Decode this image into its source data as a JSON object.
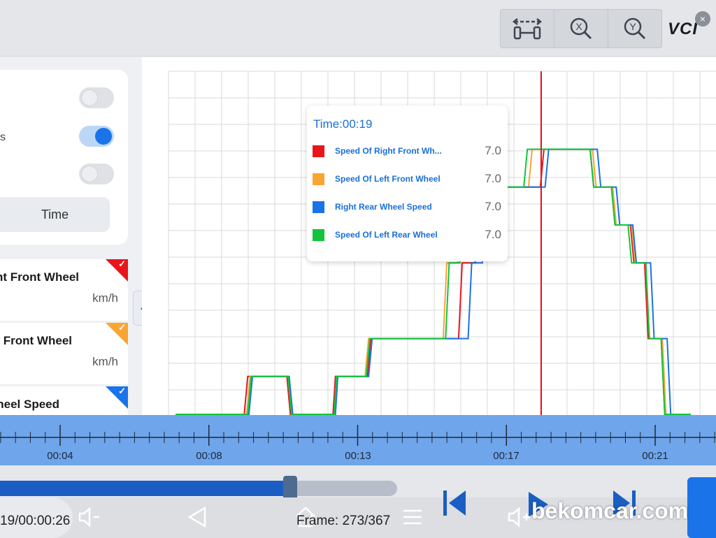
{
  "toolbar": {
    "icons": [
      "axis-expand-icon",
      "zoom-x-icon",
      "zoom-y-icon"
    ],
    "brand": "VCI",
    "brand_close": "×"
  },
  "left_panel": {
    "toggles": [
      false,
      true,
      false
    ],
    "toggle_partial_label": "s",
    "time_button": "Time"
  },
  "signals": [
    {
      "name": "nt Front Wheel",
      "unit": "km/h",
      "color": "#e8161b"
    },
    {
      "name": "Front Wheel",
      "unit": "km/h",
      "color": "#f9a533"
    },
    {
      "name": "heel Speed",
      "unit": "",
      "color": "#1a73e8"
    }
  ],
  "collapse": "«",
  "tooltip": {
    "time": "Time:00:19",
    "rows": [
      {
        "name": "Speed Of Right Front Wh...",
        "value": "7.0",
        "color": "#e8161b"
      },
      {
        "name": "Speed Of Left Front Wheel",
        "value": "7.0",
        "color": "#f9a533"
      },
      {
        "name": "Right Rear Wheel Speed",
        "value": "7.0",
        "color": "#1a73e8"
      },
      {
        "name": "Speed Of Left Rear Wheel",
        "value": "7.0",
        "color": "#12c43c"
      }
    ]
  },
  "timeline": {
    "labels": [
      "00:04",
      "00:08",
      "00:13",
      "00:17",
      "00:21"
    ]
  },
  "playback": {
    "time": "19/00:00:26",
    "frame": "Frame: 273/367",
    "progress": 0.73
  },
  "watermark": "bekomcar.com",
  "chart_data": {
    "type": "line",
    "xlabel": "",
    "ylabel": "",
    "cursor_time": "00:19",
    "series": [
      {
        "name": "Speed Of Right Front Wheel",
        "color": "#e8161b",
        "points": [
          [
            0,
            0
          ],
          [
            5.8,
            0
          ],
          [
            6.1,
            1
          ],
          [
            9.4,
            1
          ],
          [
            9.7,
            0
          ],
          [
            13.3,
            0
          ],
          [
            13.5,
            1
          ],
          [
            16.2,
            1
          ],
          [
            16.5,
            2
          ],
          [
            23.9,
            2
          ],
          [
            24.2,
            4
          ],
          [
            25.3,
            4
          ],
          [
            25.6,
            6
          ],
          [
            30.8,
            6
          ],
          [
            31.1,
            7
          ],
          [
            35.0,
            7
          ],
          [
            35.3,
            6
          ],
          [
            36.8,
            6
          ],
          [
            37.1,
            5
          ],
          [
            38.4,
            5
          ],
          [
            38.7,
            4
          ],
          [
            39.6,
            4
          ],
          [
            39.9,
            2
          ],
          [
            41.0,
            2
          ],
          [
            41.3,
            0
          ],
          [
            43.5,
            0
          ]
        ]
      },
      {
        "name": "Speed Of Left Front Wheel",
        "color": "#f9a533",
        "points": [
          [
            0,
            0
          ],
          [
            6.0,
            0
          ],
          [
            6.3,
            1
          ],
          [
            9.5,
            1
          ],
          [
            9.8,
            0
          ],
          [
            13.4,
            0
          ],
          [
            13.6,
            1
          ],
          [
            16.0,
            1
          ],
          [
            16.3,
            2
          ],
          [
            22.6,
            2
          ],
          [
            22.9,
            4
          ],
          [
            23.8,
            4
          ],
          [
            24.1,
            6
          ],
          [
            29.8,
            6
          ],
          [
            30.1,
            7
          ],
          [
            35.2,
            7
          ],
          [
            35.5,
            6
          ],
          [
            36.9,
            6
          ],
          [
            37.2,
            5
          ],
          [
            38.5,
            5
          ],
          [
            38.8,
            4
          ],
          [
            39.7,
            4
          ],
          [
            40.0,
            2
          ],
          [
            41.1,
            2
          ],
          [
            41.4,
            0
          ],
          [
            43.5,
            0
          ]
        ]
      },
      {
        "name": "Right Rear Wheel Speed",
        "color": "#1a73e8",
        "points": [
          [
            0,
            0
          ],
          [
            6.2,
            0
          ],
          [
            6.5,
            1
          ],
          [
            9.6,
            1
          ],
          [
            9.9,
            0
          ],
          [
            13.5,
            0
          ],
          [
            13.7,
            1
          ],
          [
            16.3,
            1
          ],
          [
            16.6,
            2
          ],
          [
            24.7,
            2
          ],
          [
            25.0,
            4
          ],
          [
            25.9,
            4
          ],
          [
            26.2,
            6
          ],
          [
            31.2,
            6
          ],
          [
            31.5,
            7
          ],
          [
            35.6,
            7
          ],
          [
            35.9,
            6
          ],
          [
            37.2,
            6
          ],
          [
            37.5,
            5
          ],
          [
            38.6,
            5
          ],
          [
            38.9,
            4
          ],
          [
            40.1,
            4
          ],
          [
            40.4,
            2
          ],
          [
            41.5,
            2
          ],
          [
            41.8,
            0
          ],
          [
            43.5,
            0
          ]
        ]
      },
      {
        "name": "Speed Of Left Rear Wheel",
        "color": "#12c43c",
        "points": [
          [
            0,
            0
          ],
          [
            6.1,
            0
          ],
          [
            6.4,
            1
          ],
          [
            9.5,
            1
          ],
          [
            9.8,
            0
          ],
          [
            13.4,
            0
          ],
          [
            13.6,
            1
          ],
          [
            16.1,
            1
          ],
          [
            16.4,
            2
          ],
          [
            22.8,
            2
          ],
          [
            23.1,
            4
          ],
          [
            24.0,
            4
          ],
          [
            24.3,
            6
          ],
          [
            29.4,
            6
          ],
          [
            29.7,
            7
          ],
          [
            35.0,
            7
          ],
          [
            35.3,
            6
          ],
          [
            36.8,
            6
          ],
          [
            37.1,
            5
          ],
          [
            38.2,
            5
          ],
          [
            38.5,
            4
          ],
          [
            39.7,
            4
          ],
          [
            40.0,
            2
          ],
          [
            41.0,
            2
          ],
          [
            41.3,
            0
          ],
          [
            43.5,
            0
          ]
        ]
      }
    ]
  }
}
